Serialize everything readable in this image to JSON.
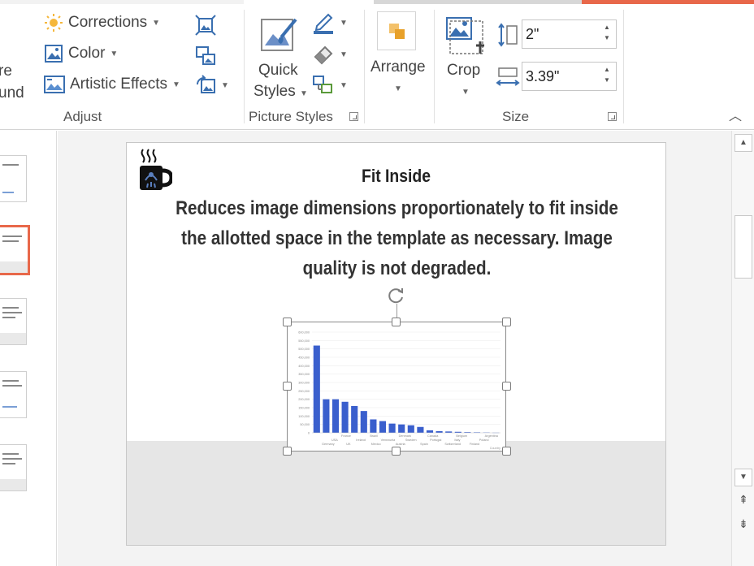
{
  "ribbon": {
    "adjust": {
      "remove_background_partial": [
        "re",
        "und"
      ],
      "corrections_label": "Corrections",
      "color_label": "Color",
      "artistic_effects_label": "Artistic Effects",
      "group_label": "Adjust"
    },
    "picture_styles": {
      "quick_styles_line1": "Quick",
      "quick_styles_line2": "Styles",
      "group_label": "Picture Styles"
    },
    "arrange": {
      "label": "Arrange"
    },
    "size": {
      "crop_label": "Crop",
      "height_value": "2\"",
      "width_value": "3.39\"",
      "group_label": "Size"
    }
  },
  "slide": {
    "title": "Fit Inside",
    "description": "Reduces image dimensions proportionately to fit inside the allotted space in the template as necessary. Image quality is not degraded."
  },
  "chart_data": {
    "type": "bar",
    "values": [
      520000,
      200000,
      200000,
      185000,
      160000,
      130000,
      80000,
      70000,
      55000,
      50000,
      45000,
      35000,
      15000,
      10000,
      8000,
      6000,
      4000,
      3000,
      2000,
      1000
    ],
    "categories": [
      "Germany",
      "France",
      "UK",
      "Ireland",
      "Brazil",
      "Mexico",
      "Denmark",
      "Venezuela",
      "Austria",
      "Canada",
      "Sweden",
      "Spain",
      "Belgium",
      "Portugal",
      "Switzerland",
      "Argentina",
      "Italy",
      "Finland",
      "Poland",
      "Norway"
    ],
    "ylim": [
      0,
      600000
    ],
    "yticks": [
      "600,000",
      "550,000",
      "500,000",
      "450,000",
      "400,000",
      "350,000",
      "300,000",
      "250,000",
      "200,000",
      "150,000",
      "100,000",
      "50,000",
      "0"
    ],
    "x_labels_row1": [
      "France",
      "Brazil",
      "Denmark",
      "Canada",
      "Belgium",
      "Argentina"
    ],
    "x_labels_row2": [
      "USA",
      "Ireland",
      "Venezuela",
      "Sweden",
      "Portugal",
      "Italy",
      "Poland"
    ],
    "x_labels_row3": [
      "Germany",
      "UK",
      "Mexico",
      "Austria",
      "Spain",
      "Switzerland",
      "Finland"
    ],
    "bar_color": "#3a5fcd",
    "xlabel": "Country",
    "grid": true
  },
  "colors": {
    "accent_orange": "#e8684a",
    "ribbon_text": "#444444"
  },
  "icons": {
    "corrections": "sun-icon",
    "color": "color-icon",
    "artistic_effects": "artistic-effects-icon",
    "compress": "compress-pictures-icon",
    "change": "change-picture-icon",
    "reset": "reset-picture-icon",
    "border": "picture-border-icon",
    "effects": "picture-effects-icon",
    "layout": "picture-layout-icon",
    "arrange": "arrange-icon",
    "crop": "crop-icon",
    "height": "shape-height-icon",
    "width": "shape-width-icon"
  }
}
